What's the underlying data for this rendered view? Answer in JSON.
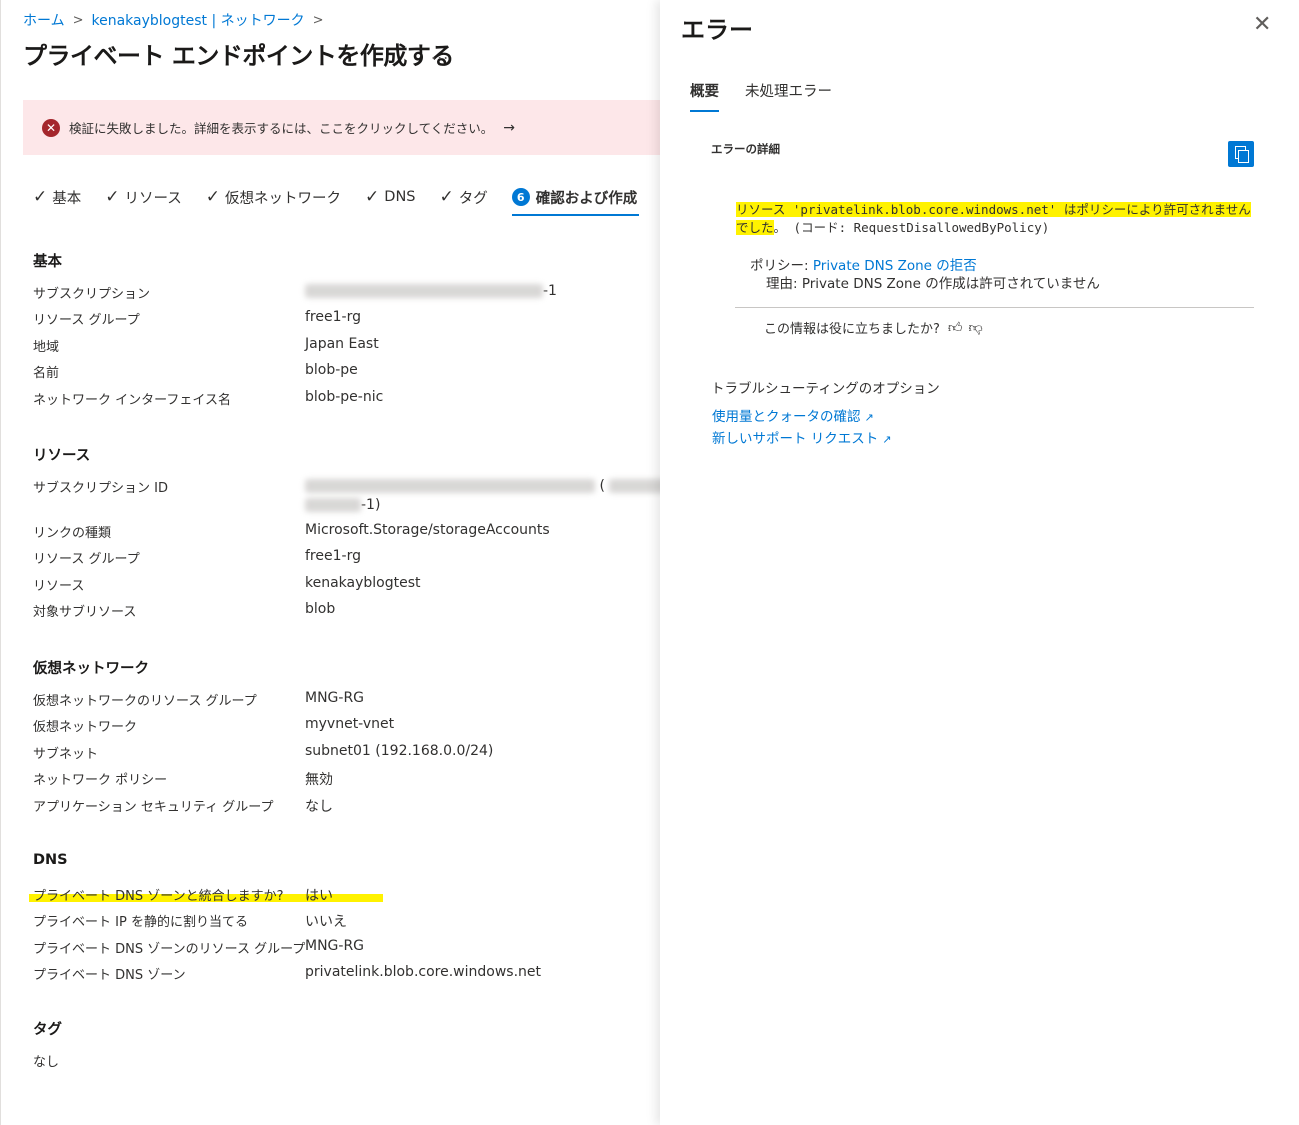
{
  "breadcrumb": [
    {
      "label": "ホーム"
    },
    {
      "label": "kenakayblogtest | ネットワーク"
    }
  ],
  "page_title": "プライベート エンドポイントを作成する",
  "more_label": "...",
  "error_banner": {
    "icon": "error-circle-icon",
    "message": "検証に失敗しました。詳細を表示するには、ここをクリックしてください。",
    "arrow": "→"
  },
  "steps": [
    {
      "label": "基本",
      "done": true
    },
    {
      "label": "リソース",
      "done": true
    },
    {
      "label": "仮想ネットワーク",
      "done": true
    },
    {
      "label": "DNS",
      "done": true
    },
    {
      "label": "タグ",
      "done": true
    },
    {
      "label": "確認および作成",
      "number": "6",
      "active": true
    }
  ],
  "sections": {
    "basics": {
      "title": "基本",
      "rows": [
        {
          "key": "サブスクリプション",
          "value": "-1"
        },
        {
          "key": "リソース グループ",
          "value": "free1-rg"
        },
        {
          "key": "地域",
          "value": "Japan East"
        },
        {
          "key": "名前",
          "value": "blob-pe"
        },
        {
          "key": "ネットワーク インターフェイス名",
          "value": "blob-pe-nic"
        }
      ]
    },
    "resource": {
      "title": "リソース",
      "rows": [
        {
          "key": "サブスクリプション ID",
          "value": "(",
          "value2": "-1)"
        },
        {
          "key": "リンクの種類",
          "value": "Microsoft.Storage/storageAccounts"
        },
        {
          "key": "リソース グループ",
          "value": "free1-rg"
        },
        {
          "key": "リソース",
          "value": "kenakayblogtest"
        },
        {
          "key": "対象サブリソース",
          "value": "blob"
        }
      ]
    },
    "vnet": {
      "title": "仮想ネットワーク",
      "rows": [
        {
          "key": "仮想ネットワークのリソース グループ",
          "value": "MNG-RG"
        },
        {
          "key": "仮想ネットワーク",
          "value": "myvnet-vnet"
        },
        {
          "key": "サブネット",
          "value": "subnet01 (192.168.0.0/24)"
        },
        {
          "key": "ネットワーク ポリシー",
          "value": "無効"
        },
        {
          "key": "アプリケーション セキュリティ グループ",
          "value": "なし"
        }
      ]
    },
    "dns": {
      "title": "DNS",
      "rows": [
        {
          "key": "プライベート DNS ゾーンと統合しますか?",
          "value": "はい"
        },
        {
          "key": "プライベート IP を静的に割り当てる",
          "value": "いいえ"
        },
        {
          "key": "プライベート DNS ゾーンのリソース グループ",
          "value": "MNG-RG"
        },
        {
          "key": "プライベート DNS ゾーン",
          "value": "privatelink.blob.core.windows.net"
        }
      ]
    },
    "tags": {
      "title": "タグ",
      "value": "なし"
    }
  },
  "panel": {
    "title": "エラー",
    "tabs": [
      {
        "label": "概要",
        "active": true
      },
      {
        "label": "未処理エラー",
        "active": false
      }
    ],
    "details_label": "エラーの詳細",
    "error_message_hl": "リソース 'privatelink.blob.core.windows.net' はポリシーにより許可されませんでした",
    "error_message_rest": "。 (コード: RequestDisallowedByPolicy)",
    "policy_label": "ポリシー:",
    "policy_link": "Private DNS Zone の拒否",
    "reason": "理由: Private DNS Zone の作成は許可されていません",
    "feedback_question": "この情報は役に立ちましたか?",
    "troubleshooting_title": "トラブルシューティングのオプション",
    "links": [
      {
        "label": "使用量とクォータの確認"
      },
      {
        "label": "新しいサポート リクエスト"
      }
    ],
    "accent_color": "#0078d4",
    "highlight_color": "#fff200"
  }
}
